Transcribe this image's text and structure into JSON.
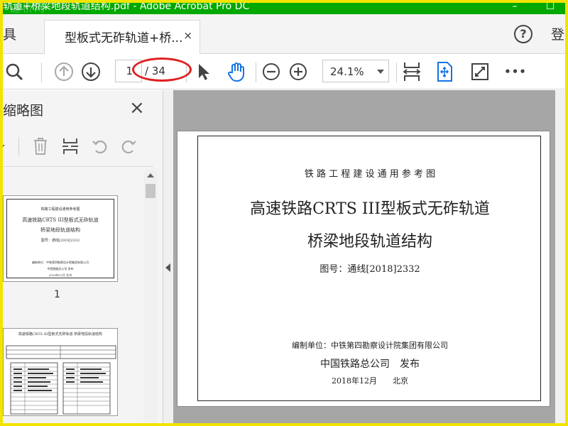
{
  "window": {
    "title": "轨道+桥梁地段轨道结构.pdf - Adobe Acrobat Pro DC",
    "watermark": "道桥网",
    "minimize": "–",
    "maximize": "☐"
  },
  "tabs": {
    "tools_label": "具",
    "active_tab": "型板式无砟轨道+桥...",
    "close_glyph": "×",
    "help_glyph": "?",
    "login_label": "登"
  },
  "toolbar": {
    "current_page": "1",
    "total_pages": "/ 34",
    "zoom": "24.1%",
    "more": "•••"
  },
  "sidepanel": {
    "title": "缩略图",
    "close_glyph": "×",
    "thumb1_number": "1",
    "thumb1_lines": [
      "铁路工程建设通用参考图",
      "高速铁路CRTS III型板式无砟轨道",
      "桥梁地段轨道结构",
      "图号：通线[2018]2332",
      "编制单位：中铁第四勘察设计院集团有限公司",
      "中国铁路总公司  发布",
      "2018年12月  北京"
    ],
    "thumb2_title": "高速铁路CRTS III型板式无砟轨道  桥梁地段轨道结构"
  },
  "document": {
    "header": "铁 路 工 程 建 设 通 用 参 考 图",
    "title_line1": "高速铁路CRTS III型板式无砟轨道",
    "title_line2": "桥梁地段轨道结构",
    "drawing_no": "图号：通线[2018]2332",
    "editor": "编制单位：中铁第四勘察设计院集团有限公司",
    "publisher": "中国铁路总公司　发布",
    "date": "2018年12月　　北京"
  },
  "colors": {
    "titlebar": "#00a800",
    "frame": "#f2e400",
    "accent_blue": "#1473e6",
    "annotation_red": "#e02020"
  }
}
